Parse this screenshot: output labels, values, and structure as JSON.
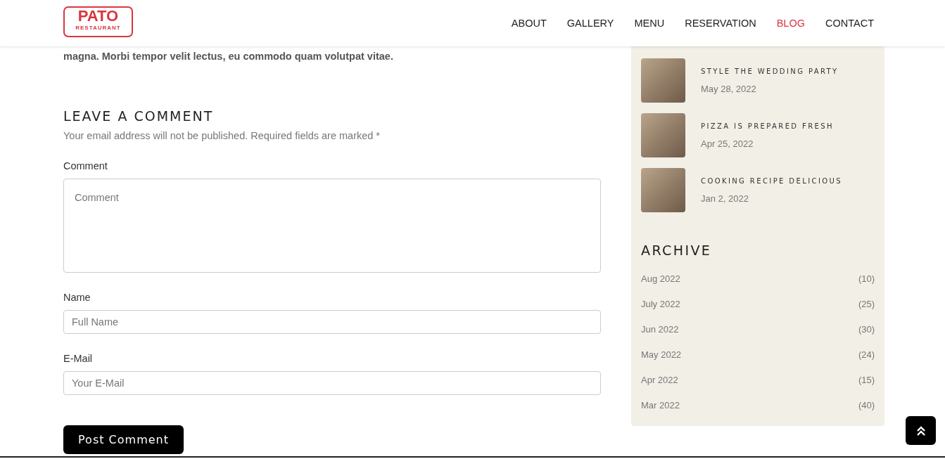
{
  "header": {
    "logo": {
      "title": "PATO",
      "subtitle": "RESTAURANT"
    },
    "nav": [
      {
        "label": "ABOUT",
        "selected": false
      },
      {
        "label": "GALLERY",
        "selected": false
      },
      {
        "label": "MENU",
        "selected": false
      },
      {
        "label": "RESERVATION",
        "selected": false
      },
      {
        "label": "BLOG",
        "selected": true
      },
      {
        "label": "CONTACT",
        "selected": false
      }
    ]
  },
  "article": {
    "paragraph": "magna. Morbi tempor velit lectus, eu commodo quam volutpat vitae."
  },
  "comment_form": {
    "title": "LEAVE A COMMENT",
    "note": "Your email address will not be published. Required fields are marked *",
    "fields": [
      {
        "kind": "textarea",
        "label": "Comment",
        "placeholder": "Comment"
      },
      {
        "kind": "input",
        "label": "Name",
        "placeholder": "Full Name"
      },
      {
        "kind": "input",
        "label": "E-Mail",
        "placeholder": "Your E-Mail"
      }
    ],
    "submit": "Post Comment"
  },
  "sidebar": {
    "recent_posts": [
      {
        "title": "STYLE THE WEDDING PARTY",
        "date": "May 28, 2022"
      },
      {
        "title": "PIZZA IS PREPARED FRESH",
        "date": "Apr 25, 2022"
      },
      {
        "title": "COOKING RECIPE DELICIOUS",
        "date": "Jan 2, 2022"
      }
    ],
    "archive": {
      "title": "ARCHIVE",
      "items": [
        {
          "month": "Aug 2022",
          "count": "(10)"
        },
        {
          "month": "July 2022",
          "count": "(25)"
        },
        {
          "month": "Jun 2022",
          "count": "(30)"
        },
        {
          "month": "May 2022",
          "count": "(24)"
        },
        {
          "month": "Apr 2022",
          "count": "(15)"
        },
        {
          "month": "Mar 2022",
          "count": "(40)"
        }
      ]
    }
  }
}
